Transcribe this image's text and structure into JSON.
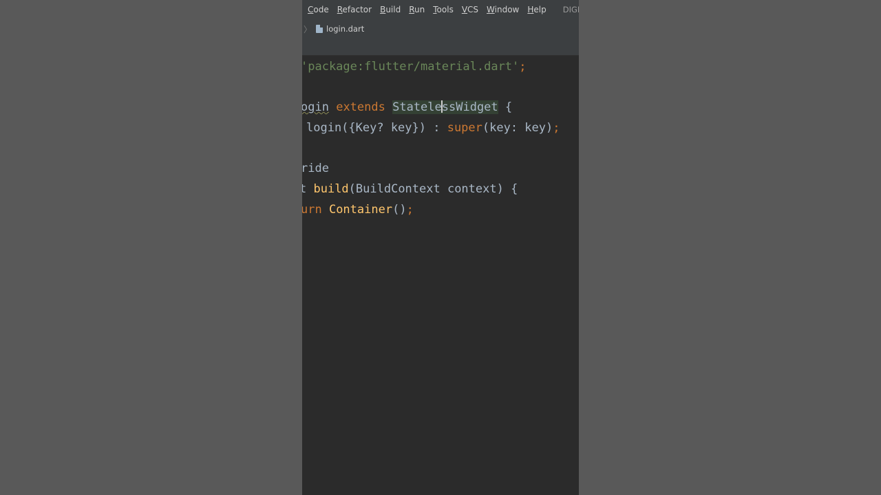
{
  "menubar": {
    "items": [
      "Code",
      "Refactor",
      "Build",
      "Run",
      "Tools",
      "VCS",
      "Window",
      "Help"
    ],
    "window_title": "DIGIAGE - I"
  },
  "navbar": {
    "file_name": "login.dart"
  },
  "code": {
    "line1": {
      "string": "'package:flutter/material.dart'",
      "semicolon": ";"
    },
    "line2": {
      "class_name": "ogin",
      "extends_kw": "extends",
      "super_part1": "Statele",
      "super_part2": "ssWidget",
      "brace": " {"
    },
    "line3": {
      "ctor": "login({Key? key}) : ",
      "super_kw": "super",
      "args": "(key: key)",
      "semicolon": ";"
    },
    "line4": {
      "annotation": "ride"
    },
    "line5": {
      "type_tail": "t ",
      "method": "build",
      "params": "(BuildContext context) {"
    },
    "line6": {
      "kw_tail": "urn ",
      "call": "Container",
      "parens": "()",
      "semicolon": ";"
    }
  },
  "colors": {
    "keyword": "#cc7832",
    "string": "#6a8759",
    "function": "#ffc66d",
    "identifier": "#a9b7c6",
    "editor_bg": "#2b2b2b",
    "toolbar_bg": "#3c3f41"
  }
}
